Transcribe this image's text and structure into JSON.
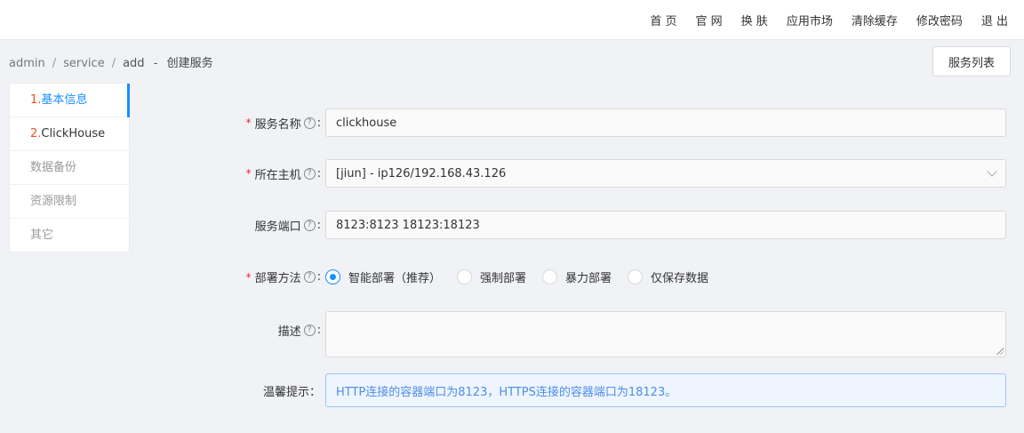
{
  "topnav": [
    "首 页",
    "官 网",
    "换 肤",
    "应用市场",
    "清除缓存",
    "修改密码",
    "退 出"
  ],
  "breadcrumb": {
    "p1": "admin",
    "p2": "service",
    "p3": "add",
    "dash": "-",
    "title": "创建服务",
    "sep": "/"
  },
  "list_button": "服务列表",
  "steps": [
    {
      "num": "1.",
      "label": "基本信息"
    },
    {
      "num": "2.",
      "label": "ClickHouse"
    },
    {
      "label": "数据备份"
    },
    {
      "label": "资源限制"
    },
    {
      "label": "其它"
    }
  ],
  "form": {
    "required_mark": "*",
    "help_glyph": "?",
    "colon": ":",
    "tip_colon": "：",
    "service_name": {
      "label": "服务名称",
      "value": "clickhouse"
    },
    "host": {
      "label": "所在主机",
      "value": "[jiun] - ip126/192.168.43.126"
    },
    "port": {
      "label": "服务端口",
      "value": "8123:8123 18123:18123"
    },
    "deploy": {
      "label": "部署方法",
      "options": [
        "智能部署（推荐）",
        "强制部署",
        "暴力部署",
        "仅保存数据"
      ],
      "selected": 0
    },
    "desc": {
      "label": "描述",
      "value": ""
    },
    "tip": {
      "label": "温馨提示",
      "value": "HTTP连接的容器端口为8123，HTTPS连接的容器端口为18123。"
    }
  },
  "colors": {
    "accent": "#1890ff",
    "required": "#f5222d",
    "step_number": "#e8541e",
    "tip_text": "#4e8ee8"
  }
}
